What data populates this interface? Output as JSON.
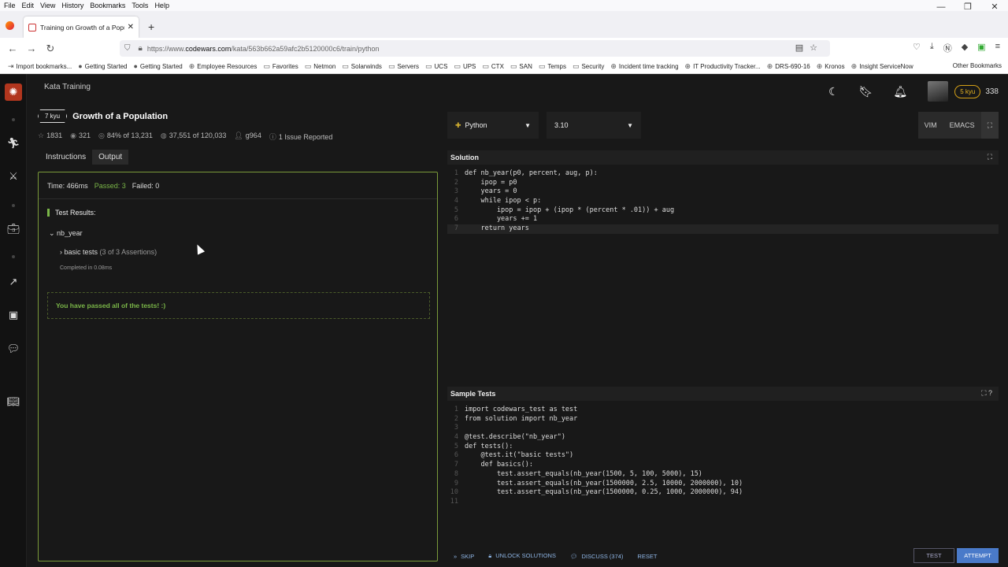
{
  "menu": [
    "File",
    "Edit",
    "View",
    "History",
    "Bookmarks",
    "Tools",
    "Help"
  ],
  "window_controls": [
    "—",
    "❐",
    "✕"
  ],
  "tab": {
    "title": "Training on Growth of a Popula",
    "close": "✕"
  },
  "new_tab": "+",
  "url": {
    "prefix": "https://www.",
    "domain": "codewars.com",
    "path": "/kata/563b662a59afc2b5120000c6/train/python"
  },
  "bookmarks": [
    {
      "icon": "⇥",
      "label": "Import bookmarks..."
    },
    {
      "icon": "●",
      "label": "Getting Started"
    },
    {
      "icon": "●",
      "label": "Getting Started"
    },
    {
      "icon": "⊕",
      "label": "Employee Resources"
    },
    {
      "icon": "▭",
      "label": "Favorites"
    },
    {
      "icon": "▭",
      "label": "Netmon"
    },
    {
      "icon": "▭",
      "label": "Solarwinds"
    },
    {
      "icon": "▭",
      "label": "Servers"
    },
    {
      "icon": "▭",
      "label": "UCS"
    },
    {
      "icon": "▭",
      "label": "UPS"
    },
    {
      "icon": "▭",
      "label": "CTX"
    },
    {
      "icon": "▭",
      "label": "SAN"
    },
    {
      "icon": "▭",
      "label": "Temps"
    },
    {
      "icon": "▭",
      "label": "Security"
    },
    {
      "icon": "⊕",
      "label": "Incident time tracking"
    },
    {
      "icon": "⊕",
      "label": "IT Productivity Tracker..."
    },
    {
      "icon": "⊕",
      "label": "DRS-690-16"
    },
    {
      "icon": "⊕",
      "label": "Kronos"
    },
    {
      "icon": "⊕",
      "label": "Insight ServiceNow"
    }
  ],
  "other_bookmarks": "Other Bookmarks",
  "app": {
    "section_title": "Kata Training",
    "rank": "5 kyu",
    "honor": "338",
    "kata": {
      "kyu": "7 kyu",
      "title": "Growth of a Population",
      "stats": {
        "stars": "1831",
        "collections": "321",
        "satisfaction": "84% of 13,231",
        "completed": "37,551 of 120,033",
        "author": "g964",
        "issues": "1 Issue Reported"
      }
    },
    "left_tabs": [
      "Instructions",
      "Output"
    ],
    "output": {
      "time": "Time: 466ms",
      "passed": "Passed: 3",
      "failed": "Failed: 0",
      "test_results": "Test Results:",
      "group": "nb_year",
      "subgroup": "basic tests",
      "assertions": "(3 of 3 Assertions)",
      "completed_in": "Completed in 0.08ms",
      "passed_message": "You have passed all of the tests! :)"
    },
    "language": "Python",
    "version": "3.10",
    "mode_buttons": [
      "VIM",
      "EMACS"
    ],
    "solution_title": "Solution",
    "sample_tests_title": "Sample Tests",
    "bottom": {
      "skip": "SKIP",
      "unlock": "UNLOCK SOLUTIONS",
      "discuss": "DISCUSS (374)",
      "reset": "RESET",
      "test": "TEST",
      "attempt": "ATTEMPT"
    }
  },
  "solution_code": [
    "def nb_year(p0, percent, aug, p):",
    "    ipop = p0",
    "    years = 0",
    "    while ipop < p:",
    "        ipop = ipop + (ipop * (percent * .01)) + aug",
    "        years += 1",
    "    return years"
  ],
  "sample_code": [
    "import codewars_test as test",
    "from solution import nb_year",
    "",
    "@test.describe(\"nb_year\")",
    "def tests():",
    "    @test.it(\"basic tests\")",
    "    def basics():",
    "        test.assert_equals(nb_year(1500, 5, 100, 5000), 15)",
    "        test.assert_equals(nb_year(1500000, 2.5, 10000, 2000000), 10)",
    "        test.assert_equals(nb_year(1500000, 0.25, 1000, 2000000), 94)",
    ""
  ],
  "colors": {
    "accent_green": "#7ab648",
    "attempt_blue": "#4a7ac9",
    "logo_red": "#b1361e"
  }
}
